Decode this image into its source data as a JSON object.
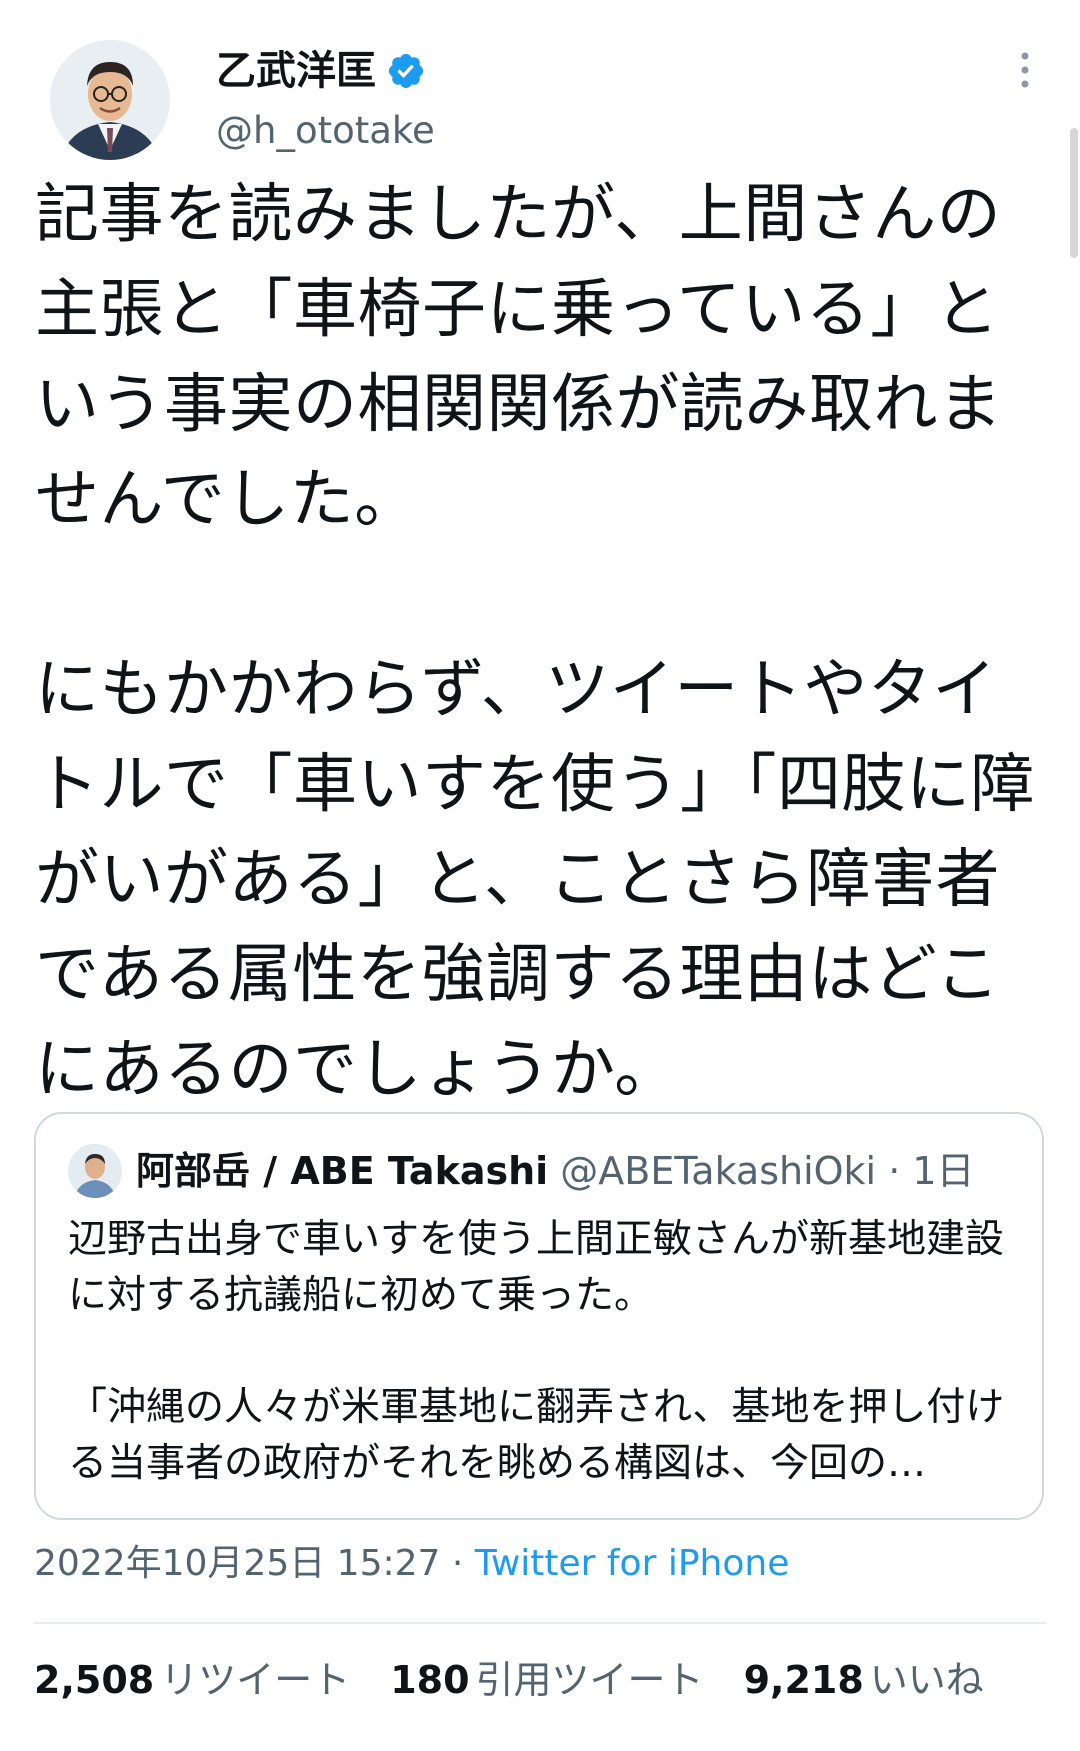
{
  "author": {
    "display_name": "乙武洋匡",
    "handle": "@h_ototake",
    "verified": true
  },
  "tweet": {
    "text": "記事を読みましたが、上間さんの主張と「車椅子に乗っている」という事実の相関関係が読み取れませんでした。\n\nにもかかわらず、ツイートやタイトルで「車いすを使う」「四肢に障がいがある」と、ことさら障害者である属性を強調する理由はどこにあるのでしょうか。"
  },
  "quoted_tweet": {
    "display_name": "阿部岳 / ABE Takashi",
    "handle": "@ABETakashiOki",
    "time": "· 1日",
    "text": "辺野古出身で車いすを使う上間正敏さんが新基地建設に対する抗議船に初めて乗った。\n\n「沖縄の人々が米軍基地に翻弄され、基地を押し付ける当事者の政府がそれを眺める構図は、今回の…"
  },
  "meta": {
    "timestamp": "2022年10月25日 15:27",
    "separator": " · ",
    "source": "Twitter for iPhone"
  },
  "stats": {
    "retweets": "2,508",
    "retweets_label": "リツイート",
    "quotes": "180",
    "quotes_label": "引用ツイート",
    "likes": "9,218",
    "likes_label": "いいね"
  },
  "colors": {
    "accent": "#1d9bf0",
    "secondary_text": "#536471",
    "border": "#cfd9de"
  }
}
